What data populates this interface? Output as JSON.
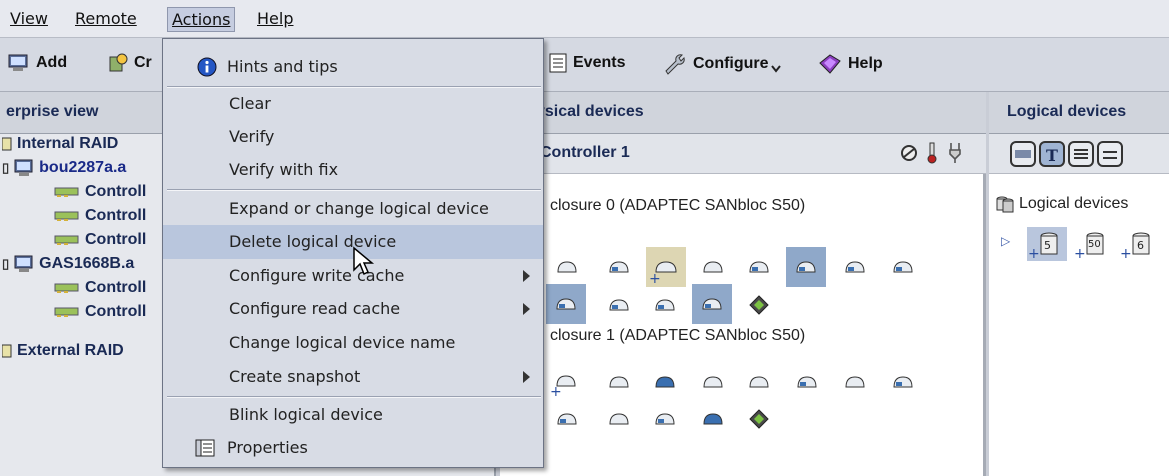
{
  "menubar": {
    "items": [
      {
        "label": "View"
      },
      {
        "label": "Remote"
      },
      {
        "label": "Actions"
      },
      {
        "label": "Help"
      }
    ]
  },
  "toolbar": {
    "add_label": "Add",
    "create_label": "Cr",
    "events_label": "Events",
    "configure_label": "Configure",
    "help_label": "Help"
  },
  "enterprise": {
    "title": "erprise view",
    "tree": [
      {
        "label": "Internal RAID"
      },
      {
        "label": "bou2287a.a"
      },
      {
        "label": "Controll"
      },
      {
        "label": "Controll"
      },
      {
        "label": "Controll"
      },
      {
        "label": "GAS1668B.a"
      },
      {
        "label": "Controll"
      },
      {
        "label": "Controll"
      },
      {
        "label": "External RAID"
      }
    ]
  },
  "physical": {
    "title": "ysical devices",
    "controller_label": "Controller 1",
    "enclosure0": "closure 0 (ADAPTEC SANbloc S50)",
    "enclosure1": "closure 1 (ADAPTEC SANbloc S50)"
  },
  "logical": {
    "title": "Logical devices",
    "tree_label": "Logical devices",
    "devices": [
      {
        "label": "5"
      },
      {
        "label": "50"
      },
      {
        "label": "6"
      }
    ]
  },
  "actions_menu": {
    "items": [
      {
        "label": "Hints and tips"
      },
      {
        "label": "Clear"
      },
      {
        "label": "Verify"
      },
      {
        "label": "Verify with fix"
      },
      {
        "label": "Expand or change logical device"
      },
      {
        "label": "Delete logical device"
      },
      {
        "label": "Configure write cache"
      },
      {
        "label": "Configure read cache"
      },
      {
        "label": "Change logical device name"
      },
      {
        "label": "Create snapshot"
      },
      {
        "label": "Blink logical device"
      },
      {
        "label": "Properties"
      }
    ]
  },
  "colors": {
    "menu_highlight": "#b9c6dd",
    "selected_drive_bg": "#8fa8c9",
    "tree_text": "#1a2a55"
  }
}
